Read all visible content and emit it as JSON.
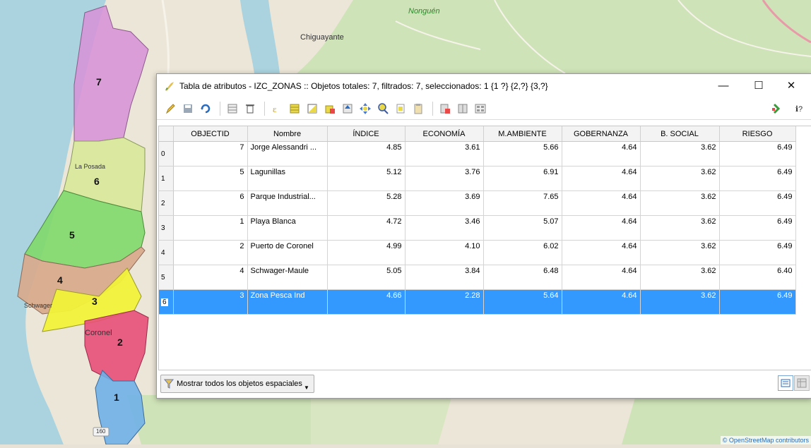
{
  "map": {
    "places": {
      "nonguen": "Nonguén",
      "chiguayante": "Chiguayante",
      "la_posada": "La Posada",
      "schwager": "Schwager",
      "coronel": "Coronel"
    },
    "zones": [
      "7",
      "6",
      "5",
      "4",
      "3",
      "2",
      "1"
    ],
    "road_badge": "160",
    "attribution": "© OpenStreetMap contributors"
  },
  "window": {
    "title": "Tabla de atributos - IZC_ZONAS :: Objetos totales: 7, filtrados: 7, seleccionados: 1 {1 ?} {2,?} {3,?}",
    "minimize": "—",
    "maximize": "☐",
    "close": "✕",
    "help": "ℹ?"
  },
  "table": {
    "columns": [
      "OBJECTID",
      "Nombre",
      "ÍNDICE",
      "ECONOMÍA",
      "M.AMBIENTE",
      "GOBERNANZA",
      "B. SOCIAL",
      "RIESGO"
    ],
    "rows": [
      {
        "row": "0",
        "objectid": "7",
        "nombre": "Jorge Alessandri ...",
        "indice": "4.85",
        "economia": "3.61",
        "ambiente": "5.66",
        "gobernanza": "4.64",
        "social": "3.62",
        "riesgo": "6.49"
      },
      {
        "row": "1",
        "objectid": "5",
        "nombre": "Lagunillas",
        "indice": "5.12",
        "economia": "3.76",
        "ambiente": "6.91",
        "gobernanza": "4.64",
        "social": "3.62",
        "riesgo": "6.49"
      },
      {
        "row": "2",
        "objectid": "6",
        "nombre": "Parque Industrial...",
        "indice": "5.28",
        "economia": "3.69",
        "ambiente": "7.65",
        "gobernanza": "4.64",
        "social": "3.62",
        "riesgo": "6.49"
      },
      {
        "row": "3",
        "objectid": "1",
        "nombre": "Playa Blanca",
        "indice": "4.72",
        "economia": "3.46",
        "ambiente": "5.07",
        "gobernanza": "4.64",
        "social": "3.62",
        "riesgo": "6.49"
      },
      {
        "row": "4",
        "objectid": "2",
        "nombre": "Puerto de Coronel",
        "indice": "4.99",
        "economia": "4.10",
        "ambiente": "6.02",
        "gobernanza": "4.64",
        "social": "3.62",
        "riesgo": "6.49"
      },
      {
        "row": "5",
        "objectid": "4",
        "nombre": "Schwager-Maule",
        "indice": "5.05",
        "economia": "3.84",
        "ambiente": "6.48",
        "gobernanza": "4.64",
        "social": "3.62",
        "riesgo": "6.40"
      },
      {
        "row": "6",
        "objectid": "3",
        "nombre": "Zona Pesca Ind",
        "indice": "4.66",
        "economia": "2.28",
        "ambiente": "5.64",
        "gobernanza": "4.64",
        "social": "3.62",
        "riesgo": "6.49"
      }
    ]
  },
  "bottom": {
    "filter_label": "Mostrar todos los objetos espaciales"
  },
  "colors": {
    "selection": "#3399ff",
    "zone7": "#d88fd8",
    "zone6": "#d8e89a",
    "zone5": "#7fd86a",
    "zone4": "#d8a88a",
    "zone3": "#f2f23a",
    "zone2": "#e84f7a",
    "zone1": "#6fb0e8"
  },
  "toolbar_icons": [
    "edit-pencil-icon",
    "save-icon",
    "reload-icon",
    "delete-attribute-icon",
    "delete-icon",
    "select-expression-icon",
    "select-all-icon",
    "invert-selection-icon",
    "deselect-icon",
    "move-top-icon",
    "pan-to-icon",
    "zoom-to-icon",
    "copy-icon",
    "paste-icon",
    "delete-column-icon",
    "new-column-icon",
    "field-calculator-icon",
    "conditional-format-icon"
  ]
}
